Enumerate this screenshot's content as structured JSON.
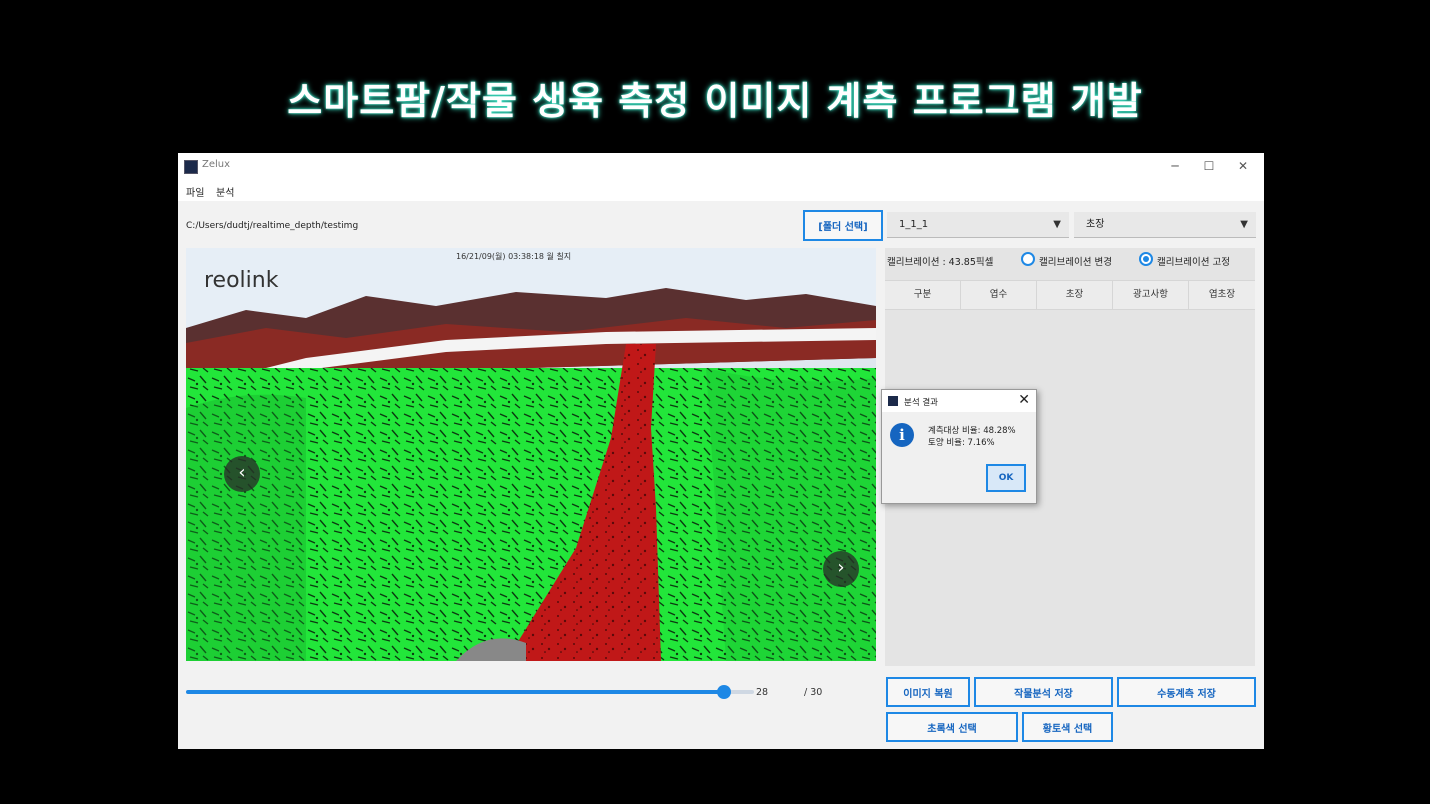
{
  "headline": "스마트팜/작물 생육 측정 이미지 계측 프로그램 개발",
  "window": {
    "title": "Zelux",
    "controls": {
      "minimize": "─",
      "maximize": "☐",
      "close": "✕"
    }
  },
  "menu": [
    "파일",
    "분석"
  ],
  "toolbar": {
    "path": "C:/Users/dudtj/realtime_depth/testimg",
    "folder_button": "[폴더 선택]",
    "combo1": "1_1_1",
    "combo2": "초장",
    "combo_arrow": "▼"
  },
  "image": {
    "watermark": "reolink",
    "timestamp": "16/21/09(월) 03:38:18 월 칠지",
    "prev_glyph": "‹",
    "next_glyph": "›"
  },
  "calibration": {
    "label": "캘리브레이션 : 43.85픽셀",
    "option_change": "캘리브레이션 변경",
    "option_fixed": "캘리브레이션 고정",
    "selected": "fixed"
  },
  "table": {
    "headers": [
      "구분",
      "엽수",
      "초장",
      "광고사항",
      "엽초장"
    ]
  },
  "slider": {
    "value": "28",
    "total": "/ 30",
    "fraction": 0.933
  },
  "buttons": {
    "restore_image": "이미지 복원",
    "save_crop_analysis": "작물분석 저장",
    "save_manual_measure": "수동계측 저장",
    "select_green": "초록색 선택",
    "select_yellow_soil": "황토색 선택"
  },
  "dialog": {
    "title": "분석 결과",
    "close": "✕",
    "icon_glyph": "i",
    "line1": "계측대상 비율: 48.28%",
    "line2": "토양 비율: 7.16%",
    "ok": "OK"
  },
  "colors": {
    "accent": "#1e88e5",
    "crop_green": "#22e63a",
    "soil_red": "#c01818",
    "headline_glow": "#3ff0d0"
  }
}
